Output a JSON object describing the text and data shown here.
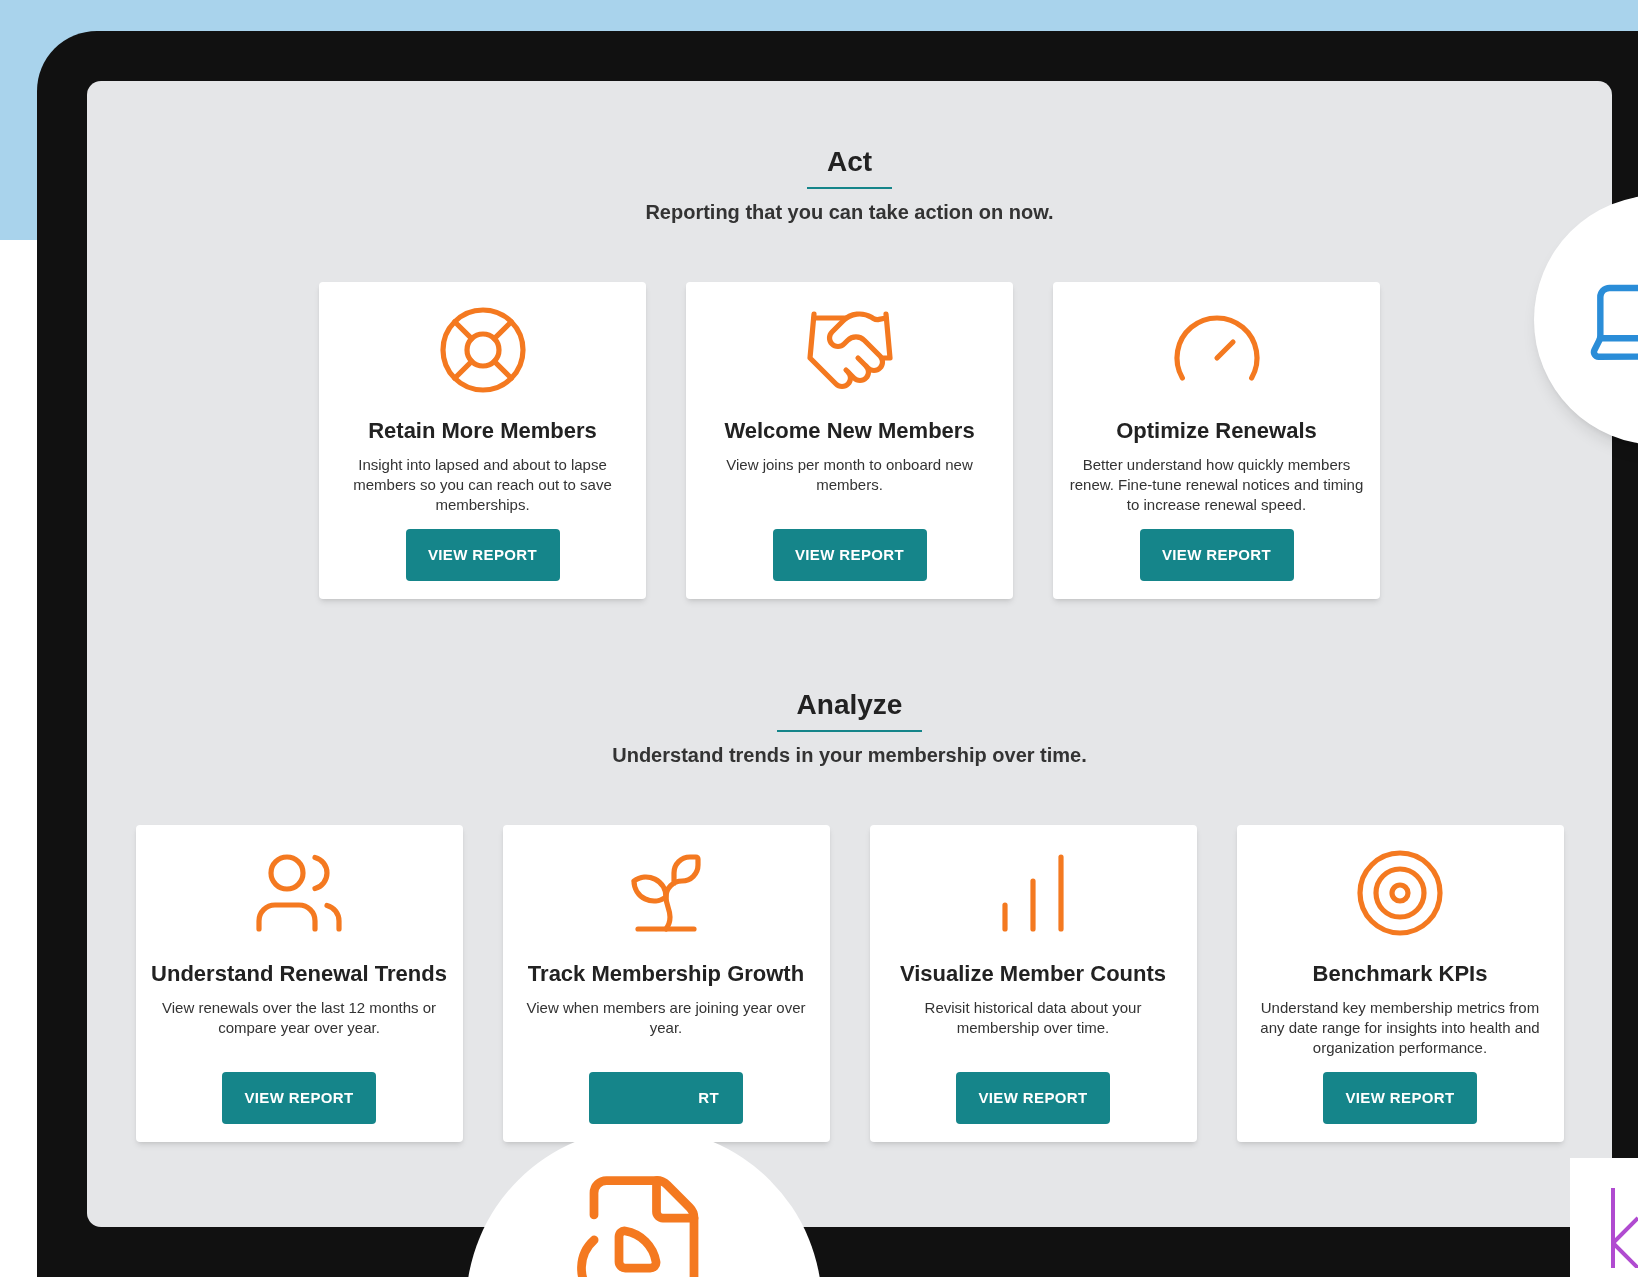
{
  "sections": [
    {
      "title": "Act",
      "subtitle": "Reporting that you can take action on now.",
      "cards": [
        {
          "title": "Retain More Members",
          "description": "Insight into lapsed and about to lapse members so you can reach out to save memberships.",
          "button": "VIEW REPORT"
        },
        {
          "title": "Welcome New Members",
          "description": "View joins per month to onboard new members.",
          "button": "VIEW REPORT"
        },
        {
          "title": "Optimize Renewals",
          "description": "Better understand how quickly members renew. Fine-tune renewal notices and timing to increase renewal speed.",
          "button": "VIEW REPORT"
        }
      ]
    },
    {
      "title": "Analyze",
      "subtitle": "Understand trends in your membership over time.",
      "cards": [
        {
          "title": "Understand Renewal Trends",
          "description": "View renewals over the last 12 months or compare year over year.",
          "button": "VIEW REPORT"
        },
        {
          "title": "Track Membership Growth",
          "description": "View when members are joining year over year.",
          "button": "RT"
        },
        {
          "title": "Visualize Member Counts",
          "description": "Revisit historical data about your membership over time.",
          "button": "VIEW REPORT"
        },
        {
          "title": "Benchmark KPIs",
          "description": "Understand key membership metrics from any date range for insights into health and organization performance.",
          "button": "VIEW REPORT"
        }
      ]
    }
  ]
}
